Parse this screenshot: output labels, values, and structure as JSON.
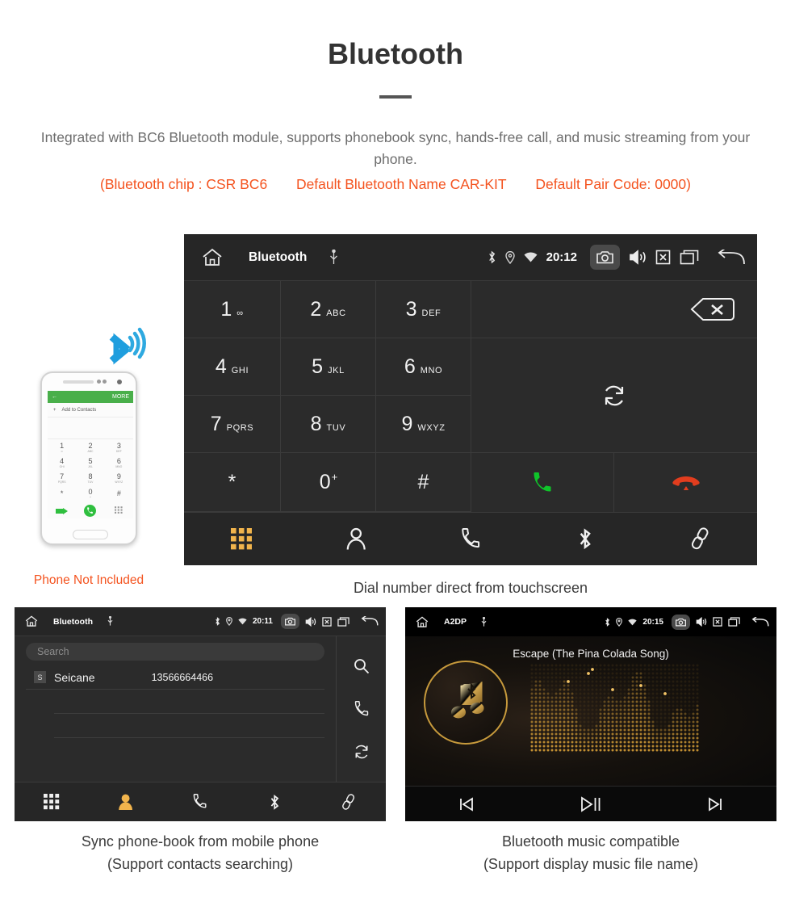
{
  "header": {
    "title": "Bluetooth",
    "subtitle": "Integrated with BC6 Bluetooth module, supports phonebook sync, hands-free call, and music streaming from your phone.",
    "spec_chip": "(Bluetooth chip : CSR BC6",
    "spec_name": "Default Bluetooth Name CAR-KIT",
    "spec_pair": "Default Pair Code: 0000)",
    "accent_color": "#f4531f",
    "subtitle_color": "#6d6d6d"
  },
  "phone_mock": {
    "not_included_label": "Phone Not Included",
    "header_more": "MORE",
    "add_to_contacts": "Add to Contacts",
    "keys": [
      {
        "num": "1",
        "sub": "∞"
      },
      {
        "num": "2",
        "sub": "ABC"
      },
      {
        "num": "3",
        "sub": "DEF"
      },
      {
        "num": "4",
        "sub": "GHI"
      },
      {
        "num": "5",
        "sub": "JKL"
      },
      {
        "num": "6",
        "sub": "MNO"
      },
      {
        "num": "7",
        "sub": "PQRS"
      },
      {
        "num": "8",
        "sub": "TUV"
      },
      {
        "num": "9",
        "sub": "WXYZ"
      },
      {
        "num": "*",
        "sub": ""
      },
      {
        "num": "0",
        "sub": "+"
      },
      {
        "num": "#",
        "sub": ""
      }
    ]
  },
  "dialer": {
    "status": {
      "title": "Bluetooth",
      "time": "20:12",
      "icons": [
        "home-icon",
        "usb-icon",
        "bluetooth-icon",
        "location-icon",
        "wifi-icon",
        "camera-icon",
        "volume-icon",
        "mute-icon",
        "recents-icon",
        "back-icon"
      ]
    },
    "keys": [
      {
        "num": "1",
        "sub": "∞"
      },
      {
        "num": "2",
        "sub": "ABC"
      },
      {
        "num": "3",
        "sub": "DEF"
      },
      {
        "num": "4",
        "sub": "GHI"
      },
      {
        "num": "5",
        "sub": "JKL"
      },
      {
        "num": "6",
        "sub": "MNO"
      },
      {
        "num": "7",
        "sub": "PQRS"
      },
      {
        "num": "8",
        "sub": "TUV"
      },
      {
        "num": "9",
        "sub": "WXYZ"
      },
      {
        "num": "*",
        "sub": ""
      },
      {
        "num": "0",
        "sub": "+"
      },
      {
        "num": "#",
        "sub": ""
      }
    ],
    "actions": {
      "backspace": "backspace-icon",
      "sync": "sync-icon",
      "call": "call-icon",
      "end_call": "end-call-icon",
      "call_color": "#0fc42a",
      "end_color": "#e23d1e"
    },
    "tabs": [
      {
        "name": "keypad",
        "icon": "keypad-icon",
        "active": true
      },
      {
        "name": "contacts",
        "icon": "person-icon",
        "active": false
      },
      {
        "name": "call-log",
        "icon": "handset-icon",
        "active": false
      },
      {
        "name": "bluetooth",
        "icon": "bluetooth-icon",
        "active": false
      },
      {
        "name": "pair",
        "icon": "link-icon",
        "active": false
      }
    ],
    "active_tab_color": "#f1b44c",
    "caption": "Dial number direct from touchscreen"
  },
  "phonebook": {
    "status": {
      "title": "Bluetooth",
      "time": "20:11"
    },
    "search_placeholder": "Search",
    "contacts": [
      {
        "initial": "S",
        "name": "Seicane",
        "number": "13566664466"
      }
    ],
    "side_actions": [
      {
        "name": "search",
        "icon": "search-icon"
      },
      {
        "name": "call",
        "icon": "handset-icon"
      },
      {
        "name": "sync",
        "icon": "sync-icon"
      }
    ],
    "tabs": [
      {
        "name": "keypad",
        "icon": "keypad-icon",
        "active": false
      },
      {
        "name": "contacts",
        "icon": "person-icon",
        "active": true
      },
      {
        "name": "call-log",
        "icon": "handset-icon",
        "active": false
      },
      {
        "name": "bluetooth",
        "icon": "bluetooth-icon",
        "active": false
      },
      {
        "name": "pair",
        "icon": "link-icon",
        "active": false
      }
    ],
    "caption_line1": "Sync phone-book from mobile phone",
    "caption_line2": "(Support contacts searching)"
  },
  "music": {
    "status": {
      "title": "A2DP",
      "time": "20:15"
    },
    "song_title": "Escape (The Pina Colada Song)",
    "controls": [
      {
        "name": "previous",
        "icon": "previous-icon"
      },
      {
        "name": "play-pause",
        "icon": "play-pause-icon"
      },
      {
        "name": "next",
        "icon": "next-icon"
      }
    ],
    "accent_gold": "#c79a3c",
    "caption_line1": "Bluetooth music compatible",
    "caption_line2": "(Support display music file name)"
  }
}
